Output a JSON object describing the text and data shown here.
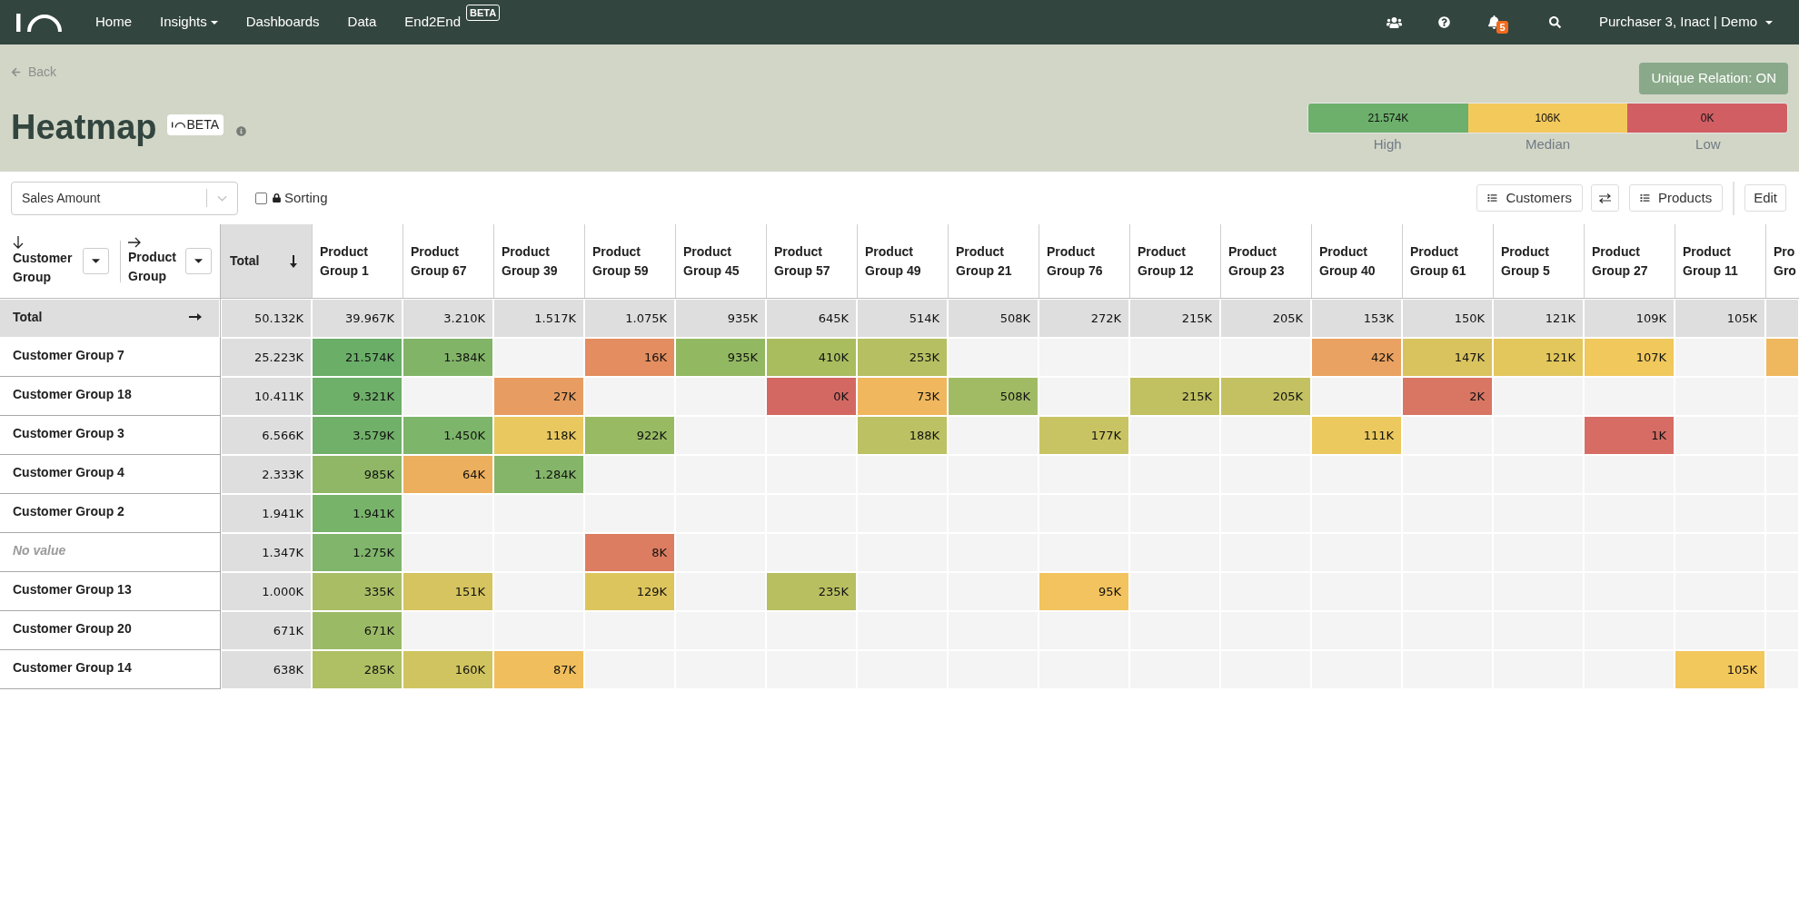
{
  "nav": {
    "items": [
      {
        "label": "Home",
        "kind": "link"
      },
      {
        "label": "Insights",
        "kind": "dropdown"
      },
      {
        "label": "Dashboards",
        "kind": "link"
      },
      {
        "label": "Data",
        "kind": "link"
      },
      {
        "label": "End2End",
        "kind": "link",
        "badge": "BETA"
      }
    ],
    "notification_count": "5",
    "user_menu": "Purchaser 3, Inact | Demo"
  },
  "header": {
    "back": "Back",
    "title": "Heatmap",
    "title_badge": "BETA",
    "unique_relation_button": "Unique Relation: ON",
    "legend": [
      {
        "value": "21.574K",
        "label": "High",
        "color": "#6cb06b"
      },
      {
        "value": "106K",
        "label": "Median",
        "color": "#f3c95c"
      },
      {
        "value": "0K",
        "label": "Low",
        "color": "#d05e63"
      }
    ]
  },
  "toolbar": {
    "measure_select": {
      "value": "Sales Amount"
    },
    "sorting": {
      "label": "Sorting",
      "checked": false
    },
    "customers_button": "Customers",
    "products_button": "Products",
    "edit_button": "Edit"
  },
  "table": {
    "row_axis": "Customer Group",
    "column_axis": "Product Group",
    "total_header": "Total",
    "total_row": {
      "label": "Total",
      "total": "50.132K"
    },
    "columns": [
      {
        "label": "Product Group 1",
        "total": "39.967K"
      },
      {
        "label": "Product Group 67",
        "total": "3.210K"
      },
      {
        "label": "Product Group 39",
        "total": "1.517K"
      },
      {
        "label": "Product Group 59",
        "total": "1.075K"
      },
      {
        "label": "Product Group 45",
        "total": "935K"
      },
      {
        "label": "Product Group 57",
        "total": "645K"
      },
      {
        "label": "Product Group 49",
        "total": "514K"
      },
      {
        "label": "Product Group 21",
        "total": "508K"
      },
      {
        "label": "Product Group 76",
        "total": "272K"
      },
      {
        "label": "Product Group 12",
        "total": "215K"
      },
      {
        "label": "Product Group 23",
        "total": "205K"
      },
      {
        "label": "Product Group 40",
        "total": "153K"
      },
      {
        "label": "Product Group 61",
        "total": "150K"
      },
      {
        "label": "Product Group 5",
        "total": "121K"
      },
      {
        "label": "Product Group 27",
        "total": "109K"
      },
      {
        "label": "Product Group 11",
        "total": "105K"
      },
      {
        "label": "Pro Gro"
      }
    ],
    "rows": [
      {
        "label": "Customer Group 7",
        "kind": "group",
        "total": "25.223K",
        "cells": [
          {
            "value": "21.574K",
            "color": "#6aae68"
          },
          {
            "value": "1.384K",
            "color": "#82b468"
          },
          null,
          {
            "value": "16K",
            "color": "#e38d60"
          },
          {
            "value": "935K",
            "color": "#93b862"
          },
          {
            "value": "410K",
            "color": "#a9bd5f"
          },
          {
            "value": "253K",
            "color": "#b6c062"
          },
          null,
          null,
          null,
          null,
          {
            "value": "42K",
            "color": "#e9a261"
          },
          {
            "value": "147K",
            "color": "#d9c35e"
          },
          {
            "value": "121K",
            "color": "#e3c75d"
          },
          {
            "value": "107K",
            "color": "#f0c85c"
          },
          null,
          {
            "color": "#efb85e"
          }
        ]
      },
      {
        "label": "Customer Group 18",
        "kind": "group",
        "total": "10.411K",
        "cells": [
          {
            "value": "9.321K",
            "color": "#6eaf69"
          },
          null,
          {
            "value": "27K",
            "color": "#e79d61"
          },
          null,
          null,
          {
            "value": "0K",
            "color": "#d36863"
          },
          {
            "value": "73K",
            "color": "#f0b75e"
          },
          {
            "value": "508K",
            "color": "#a0bb64"
          },
          null,
          {
            "value": "215K",
            "color": "#c1c162"
          },
          {
            "value": "205K",
            "color": "#c3c162"
          },
          null,
          {
            "value": "2K",
            "color": "#d97563"
          }
        ]
      },
      {
        "label": "Customer Group 3",
        "kind": "group",
        "total": "6.566K",
        "cells": [
          {
            "value": "3.579K",
            "color": "#70b069"
          },
          {
            "value": "1.450K",
            "color": "#7db56a"
          },
          {
            "value": "118K",
            "color": "#e8c85f"
          },
          {
            "value": "922K",
            "color": "#97ba63"
          },
          null,
          null,
          {
            "value": "188K",
            "color": "#bcc163"
          },
          null,
          {
            "value": "177K",
            "color": "#c9c463"
          },
          null,
          null,
          {
            "value": "111K",
            "color": "#ecc95e"
          },
          null,
          null,
          {
            "value": "1K",
            "color": "#d66c64"
          }
        ]
      },
      {
        "label": "Customer Group 4",
        "kind": "group",
        "total": "2.333K",
        "cells": [
          {
            "value": "985K",
            "color": "#8fb766"
          },
          {
            "value": "64K",
            "color": "#ecaf5d"
          },
          {
            "value": "1.284K",
            "color": "#84b569"
          }
        ]
      },
      {
        "label": "Customer Group 2",
        "kind": "group",
        "total": "1.941K",
        "cells": [
          {
            "value": "1.941K",
            "color": "#78b36a"
          }
        ]
      },
      {
        "label": "No value",
        "kind": "missing",
        "total": "1.347K",
        "cells": [
          {
            "value": "1.275K",
            "color": "#80b56b"
          },
          null,
          null,
          {
            "value": "8K",
            "color": "#dc7d62"
          }
        ]
      },
      {
        "label": "Customer Group 13",
        "kind": "group",
        "total": "1.000K",
        "cells": [
          {
            "value": "335K",
            "color": "#a9bd64"
          },
          {
            "value": "151K",
            "color": "#d5c45f"
          },
          null,
          {
            "value": "129K",
            "color": "#ddc55d"
          },
          null,
          {
            "value": "235K",
            "color": "#b8bf61"
          },
          null,
          null,
          {
            "value": "95K",
            "color": "#f2c35e"
          }
        ]
      },
      {
        "label": "Customer Group 20",
        "kind": "group",
        "total": "671K",
        "cells": [
          {
            "value": "671K",
            "color": "#9bba65"
          }
        ]
      },
      {
        "label": "Customer Group 14",
        "kind": "group",
        "total": "638K",
        "cells": [
          {
            "value": "285K",
            "color": "#afbf63"
          },
          {
            "value": "160K",
            "color": "#d0c460"
          },
          {
            "value": "87K",
            "color": "#f0be5c"
          },
          null,
          null,
          null,
          null,
          null,
          null,
          null,
          null,
          null,
          null,
          null,
          null,
          {
            "value": "105K",
            "color": "#f2c75c"
          }
        ]
      }
    ]
  }
}
